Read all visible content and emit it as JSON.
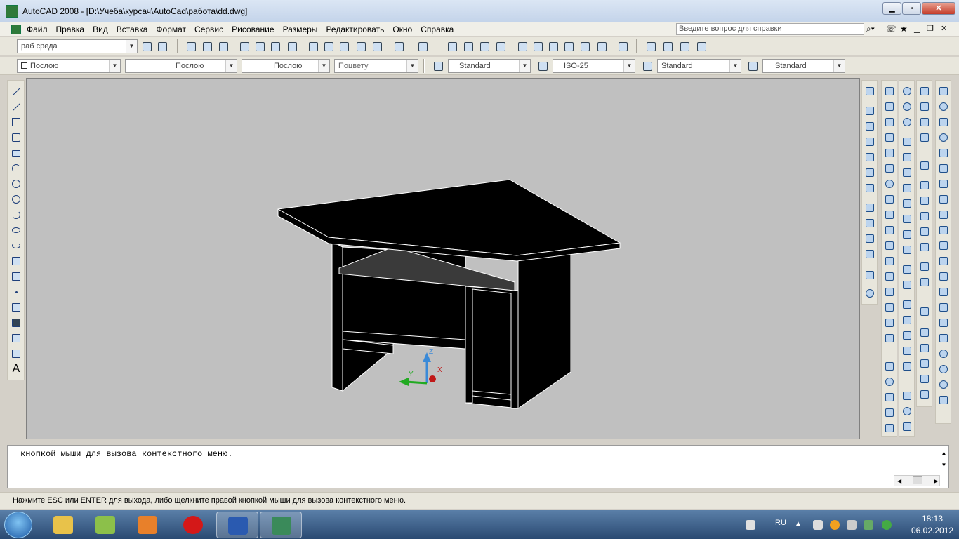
{
  "window": {
    "title": "AutoCAD 2008 - [D:\\Учеба\\курсач\\AutoCad\\работа\\dd.dwg]"
  },
  "menu": {
    "items": [
      "Файл",
      "Правка",
      "Вид",
      "Вставка",
      "Формат",
      "Сервис",
      "Рисование",
      "Размеры",
      "Редактировать",
      "Окно",
      "Справка"
    ],
    "help_placeholder": "Введите вопрос для справки"
  },
  "toolbar1": {
    "workspace": "раб среда"
  },
  "toolbar2": {
    "layer": "Послою",
    "linetype": "Послою",
    "lineweight": "Послою",
    "plotstyle": "Поцвету",
    "textstyle": "Standard",
    "dimstyle": "ISO-25",
    "tablestyle": "Standard",
    "multileaderstyle": "Standard"
  },
  "command": {
    "line1": "кнопкой мыши для вызова контекстного меню."
  },
  "status": {
    "text": "Нажмите ESC или ENTER для выхода, либо щелкните правой кнопкой мыши для вызова контекстного меню."
  },
  "ucs": {
    "x": "X",
    "y": "Y",
    "z": "Z"
  },
  "left_tb": {
    "text_tool": "A"
  },
  "taskbar": {
    "lang": "RU",
    "time": "18:13",
    "date": "06.02.2012"
  },
  "colors": {
    "viewport": "#c0c0c0",
    "model": "#000000",
    "shelf": "#3a3a3a",
    "edge": "#ffffff"
  }
}
